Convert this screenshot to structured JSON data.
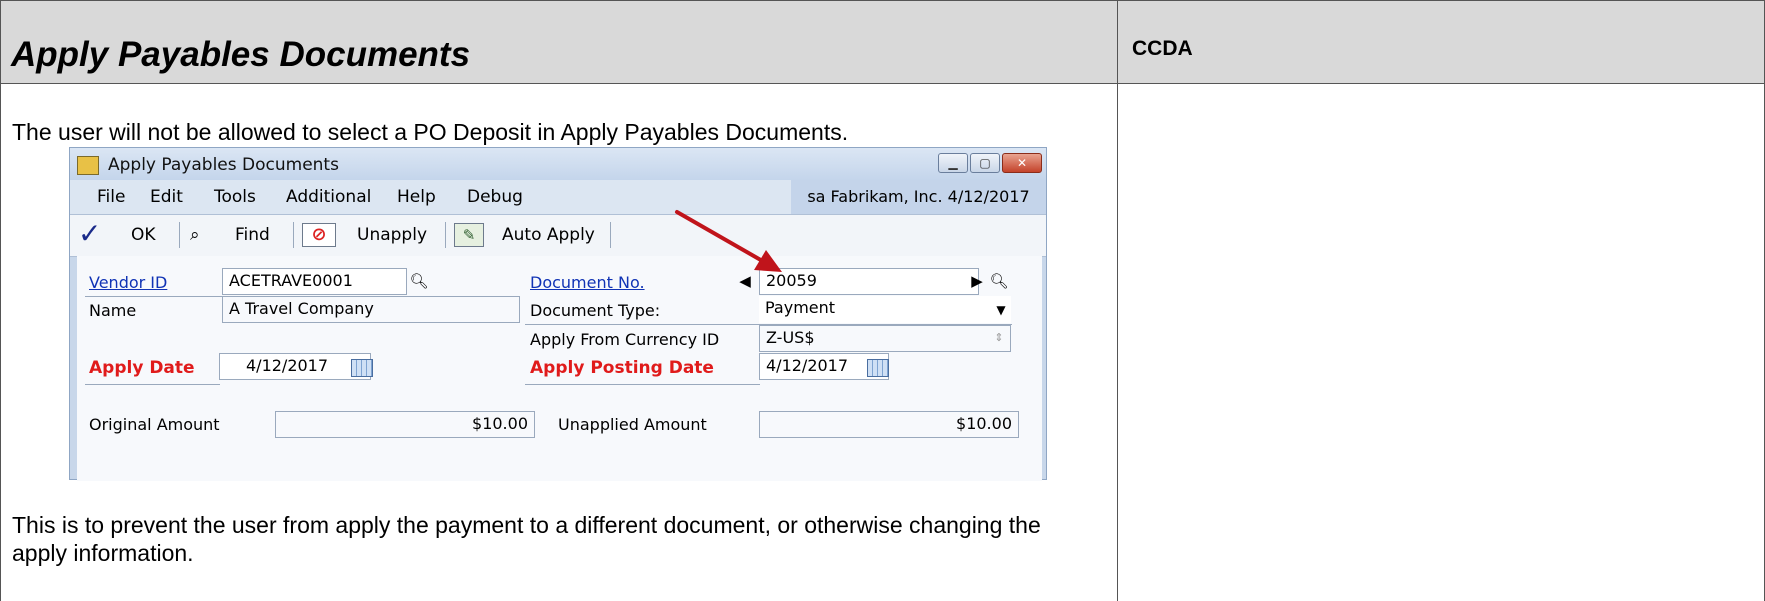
{
  "header": {
    "title": "Apply Payables Documents",
    "right_label": "CCDA"
  },
  "paragraphs": {
    "intro": "The user will not be allowed to select a PO Deposit in Apply Payables Documents.",
    "note": "This is to prevent the user from apply the payment to a different document, or otherwise changing the apply information."
  },
  "window": {
    "title": "Apply Payables Documents",
    "menu": [
      "File",
      "Edit",
      "Tools",
      "Additional",
      "Help",
      "Debug"
    ],
    "user_info": "sa  Fabrikam, Inc.  4/12/2017",
    "toolbar": {
      "ok": "OK",
      "find": "Find",
      "unapply": "Unapply",
      "auto_apply": "Auto Apply"
    },
    "form": {
      "vendor_id_label": "Vendor ID",
      "vendor_id": "ACETRAVE0001",
      "name_label": "Name",
      "name": "A Travel Company",
      "apply_date_label": "Apply Date",
      "apply_date": "4/12/2017",
      "document_no_label": "Document No.",
      "document_no": "20059",
      "document_type_label": "Document Type:",
      "document_type": "Payment",
      "currency_label": "Apply From Currency ID",
      "currency": "Z-US$",
      "posting_date_label": "Apply Posting Date",
      "posting_date": "4/12/2017",
      "original_amount_label": "Original Amount",
      "original_amount": "$10.00",
      "unapplied_amount_label": "Unapplied Amount",
      "unapplied_amount": "$10.00"
    }
  },
  "colors": {
    "required_label": "#e01b1b",
    "link": "#1033b5",
    "arrow": "#c0141b"
  }
}
